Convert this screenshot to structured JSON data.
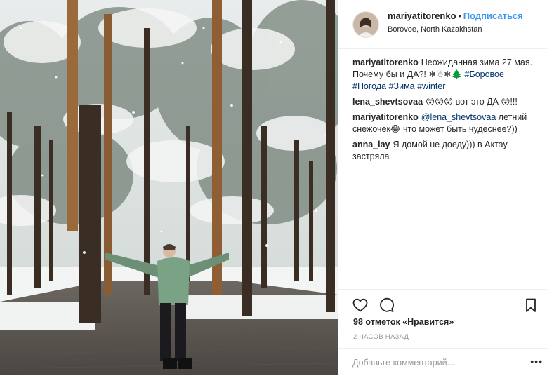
{
  "post": {
    "author": {
      "username": "mariyatitorenko",
      "separator": "•",
      "follow_label": "Подписаться",
      "location": "Borovoe, North Kazakhstan"
    },
    "caption": {
      "author": "mariyatitorenko",
      "text": "Неожиданная зима 27 мая. Почему бы и ДА?! ❄☃❄🌲 ",
      "tags": [
        "#Боровое",
        "#Погода",
        "#Зима",
        "#winter"
      ]
    },
    "comments": [
      {
        "author": "lena_shevtsovaa",
        "text": "😲😲😲 вот это ДА 😲!!!"
      },
      {
        "author": "mariyatitorenko",
        "mention": "@lena_shevtsovaa",
        "text": " летний снежочек😂 что может быть чудеснее?))"
      },
      {
        "author": "anna_iay",
        "text": "Я домой не доеду))) в Актау застряла"
      }
    ],
    "likes_label": "98 отметок «Нравится»",
    "time_ago": "2 ЧАСОВ НАЗАД",
    "add_comment_placeholder": "Добавьте комментарий...",
    "more_label": "•••"
  },
  "icons": {
    "like": "heart-outline-icon",
    "comment": "speech-bubble-icon",
    "save": "bookmark-icon"
  },
  "colors": {
    "link": "#003569",
    "follow": "#3897f0",
    "muted": "#999999",
    "text": "#262626"
  }
}
